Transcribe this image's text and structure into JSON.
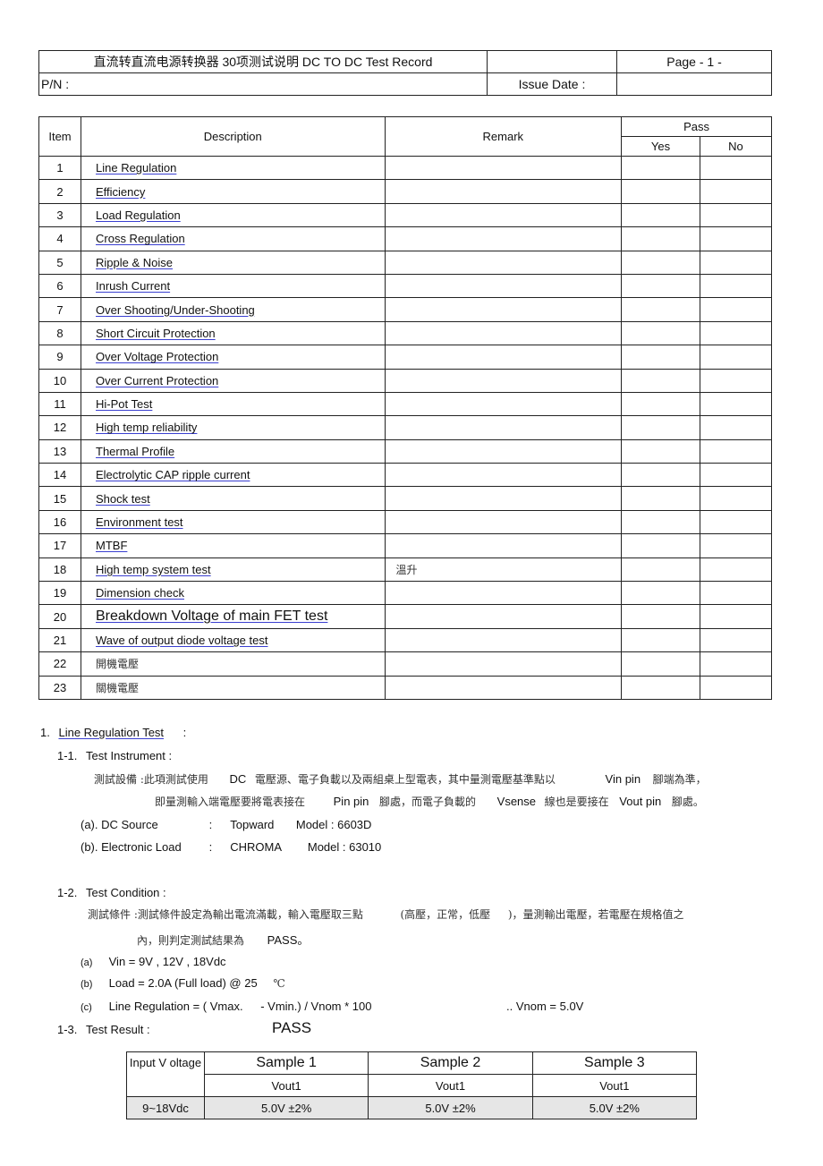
{
  "header": {
    "title": "直流转直流电源转换器    30项测试说明   DC TO DC Test Record",
    "page": "Page - 1  -",
    "pn_label": "P/N :",
    "issue_date_label": "Issue Date :"
  },
  "items_table": {
    "columns": {
      "item": "Item",
      "description": "Description",
      "remark": "Remark",
      "pass": "Pass",
      "yes": "Yes",
      "no": "No"
    },
    "rows": [
      {
        "item": "1",
        "description": "Line Regulation",
        "remark": ""
      },
      {
        "item": "2",
        "description": "Efficiency",
        "remark": ""
      },
      {
        "item": "3",
        "description": "Load Regulation",
        "remark": ""
      },
      {
        "item": "4",
        "description": "Cross Regulation",
        "remark": ""
      },
      {
        "item": "5",
        "description": "Ripple & Noise",
        "remark": ""
      },
      {
        "item": "6",
        "description": "Inrush Current",
        "remark": ""
      },
      {
        "item": "7",
        "description": "Over Shooting/Under-Shooting",
        "remark": ""
      },
      {
        "item": "8",
        "description": "Short Circuit Protection",
        "remark": ""
      },
      {
        "item": "9",
        "description": "Over Voltage Protection",
        "remark": ""
      },
      {
        "item": "10",
        "description": "Over Current Protection",
        "remark": ""
      },
      {
        "item": "11",
        "description": "Hi-Pot Test",
        "remark": ""
      },
      {
        "item": "12",
        "description": "High temp reliability",
        "remark": ""
      },
      {
        "item": "13",
        "description": "Thermal Profile",
        "remark": ""
      },
      {
        "item": "14",
        "description": "Electrolytic CAP ripple current",
        "remark": ""
      },
      {
        "item": "15",
        "description": "Shock test",
        "remark": ""
      },
      {
        "item": "16",
        "description": "Environment test",
        "remark": ""
      },
      {
        "item": "17",
        "description": "MTBF",
        "remark": ""
      },
      {
        "item": "18",
        "description": "High temp system test",
        "remark": "溫升"
      },
      {
        "item": "19",
        "description": "Dimension check",
        "remark": ""
      },
      {
        "item": "20",
        "description": "Breakdown Voltage of main FET test",
        "remark": ""
      },
      {
        "item": "21",
        "description": "Wave of output diode voltage test",
        "remark": ""
      },
      {
        "item": "22",
        "description": "開機電壓",
        "remark": ""
      },
      {
        "item": "23",
        "description": "關機電壓",
        "remark": ""
      }
    ]
  },
  "section1": {
    "heading_num": "1.",
    "heading": "Line Regulation Test",
    "heading_colon": ":",
    "instrument": {
      "num": "1-1.",
      "title": "Test Instrument :",
      "desc_line1": [
        "測試設備 :此項測試使用",
        "DC",
        "電壓源、電子負載以及兩組桌上型電表，其中量測電壓基準點以",
        "Vin pin",
        "腳端為準，"
      ],
      "desc_line2": [
        "即量測輸入端電壓要將電表接在",
        "Pin pin",
        "腳處，而電子負載的",
        "Vsense",
        "線也是要接在",
        "Vout pin",
        "腳處。"
      ],
      "a_label": "(a). DC Source",
      "a_colon": ":",
      "a_brand": "Topward",
      "a_model": "Model : 6603D",
      "b_label": "(b). Electronic Load",
      "b_colon": ":",
      "b_brand": "CHROMA",
      "b_model": "Model : 63010"
    },
    "condition": {
      "num": "1-2.",
      "title": "Test Condition :",
      "desc_line1": [
        "測試條件 :測試條件設定為輸出電流滿載，輸入電壓取三點",
        "(高壓，正常，低壓",
        ")，量測輸出電壓，若電壓在規格值之"
      ],
      "desc_line2": [
        "內，則判定測試結果為",
        "PASS。"
      ],
      "a_marker": "(a)",
      "a_text": "Vin = 9V , 12V , 18Vdc",
      "b_marker": "(b)",
      "b_text": "Load = 2.0A (Full load) @ 25",
      "b_unit": "℃",
      "c_marker": "(c)",
      "c_text1": "Line Regulation = ( Vmax.",
      "c_text2": "- Vmin.) / Vnom * 100",
      "c_note": ".. Vnom = 5.0V"
    },
    "result": {
      "num": "1-3.",
      "title": "Test Result :",
      "verdict": "PASS"
    }
  },
  "result_table": {
    "input_header": "Input V oltage",
    "samples": [
      "Sample 1",
      "Sample 2",
      "Sample 3"
    ],
    "sub_headers": [
      "Vout1",
      "Vout1",
      "Vout1"
    ],
    "row": {
      "input": "9~18Vdc",
      "values": [
        "5.0V ±2%",
        "5.0V ±2%",
        "5.0V ±2%"
      ]
    }
  }
}
